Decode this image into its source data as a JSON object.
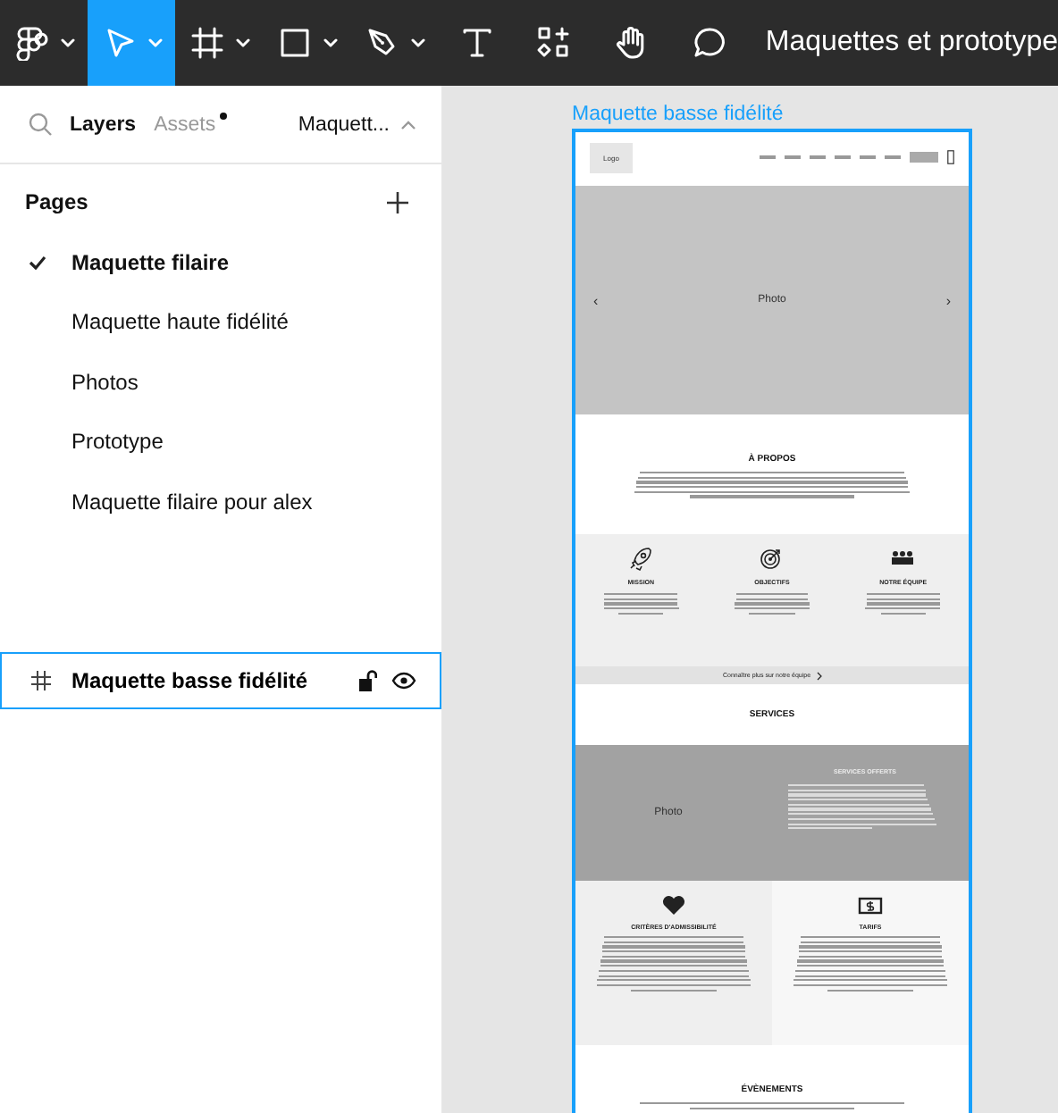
{
  "toolbar": {
    "tools": [
      {
        "kind": "logo",
        "selected": false,
        "menu": true
      },
      {
        "kind": "move",
        "selected": true,
        "menu": true
      },
      {
        "kind": "frame",
        "selected": false,
        "menu": true
      },
      {
        "kind": "shape",
        "selected": false,
        "menu": true
      },
      {
        "kind": "pen",
        "selected": false,
        "menu": true
      },
      {
        "kind": "text",
        "selected": false,
        "menu": false
      },
      {
        "kind": "components",
        "selected": false,
        "menu": false
      },
      {
        "kind": "hand",
        "selected": false,
        "menu": false
      },
      {
        "kind": "comment",
        "selected": false,
        "menu": false
      }
    ],
    "title": "Maquettes et prototype"
  },
  "panel": {
    "tabs": [
      {
        "label": "Layers",
        "selected": true,
        "badge": false
      },
      {
        "label": "Assets",
        "selected": false,
        "badge": true
      }
    ],
    "page_switch": "Maquett...",
    "pages_title": "Pages",
    "pages": [
      {
        "label": "Maquette filaire",
        "selected": true
      },
      {
        "label": "Maquette haute fidélité",
        "selected": false
      },
      {
        "label": "Photos",
        "selected": false
      },
      {
        "label": "Prototype",
        "selected": false
      },
      {
        "label": "Maquette filaire pour alex",
        "selected": false
      }
    ],
    "layers": [
      {
        "name": "Maquette basse fidélité",
        "selected": true,
        "locked": false,
        "visible": true
      }
    ]
  },
  "canvas": {
    "frame_label": "Maquette basse fidélité",
    "header": {
      "logo": "Logo"
    },
    "hero": {
      "photo": "Photo",
      "prev": "‹",
      "next": "›"
    },
    "about": {
      "title": "À PROPOS"
    },
    "features": [
      {
        "title": "MISSION"
      },
      {
        "title": "OBJECTIFS"
      },
      {
        "title": "NOTRE ÉQUIPE"
      }
    ],
    "team_link": "Connaître plus sur notre équipe",
    "services": {
      "title": "SERVICES",
      "photo": "Photo",
      "offer_title": "SERVICES OFFERTS"
    },
    "cards": [
      {
        "title": "CRITÈRES D'ADMISSIBILITÉ"
      },
      {
        "title": "TARIFS"
      }
    ],
    "events": {
      "title": "ÉVÈNEMENTS"
    }
  }
}
